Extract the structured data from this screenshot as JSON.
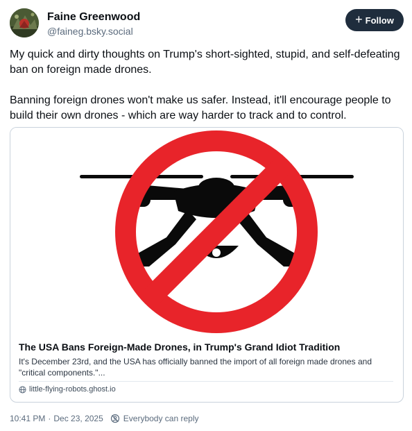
{
  "author": {
    "name": "Faine Greenwood",
    "handle": "@faineg.bsky.social"
  },
  "follow_button": {
    "label": "Follow",
    "icon": "plus-icon"
  },
  "post": {
    "paragraphs": [
      "My quick and dirty thoughts on Trump's short-sighted, stupid, and self-defeating ban on foreign made drones.",
      "Banning foreign drones won't make us safer. Instead, it'll encourage people to build their own drones - which are way harder to track and to control."
    ]
  },
  "link_card": {
    "image_icon": "no-drones-icon",
    "title": "The USA Bans Foreign-Made Drones, in Trump's Grand Idiot Tradition",
    "description": "It's December 23rd, and the USA has officially banned the import of all foreign made drones and \"critical components.\"...",
    "domain": "little-flying-robots.ghost.io",
    "domain_icon": "globe-icon"
  },
  "footer": {
    "time": "10:41 PM",
    "date": "Dec 23, 2025",
    "separator": "·",
    "reply_setting": "Everybody can reply",
    "reply_icon": "reply-settings-icon"
  },
  "colors": {
    "follow_bg": "#1f2d3d",
    "prohibition_red": "#e8242a",
    "drone_black": "#0a0a0a",
    "border": "#c9d2dc",
    "muted_text": "#5b6b7d"
  }
}
